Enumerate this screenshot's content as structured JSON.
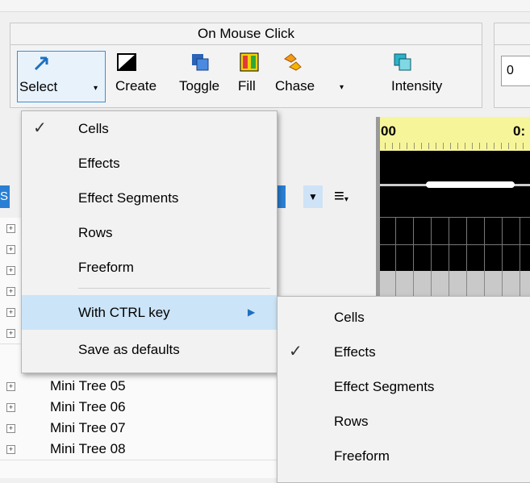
{
  "ribbon": {
    "group_title": "On Mouse Click",
    "buttons": [
      {
        "label": "Select"
      },
      {
        "label": "Create"
      },
      {
        "label": "Toggle"
      },
      {
        "label": "Fill"
      },
      {
        "label": "Chase"
      },
      {
        "label": "Intensity"
      }
    ],
    "value_field": "0"
  },
  "timeline": {
    "ruler_left": "00",
    "ruler_right": "0:"
  },
  "select_menu": {
    "items": [
      {
        "label": "Cells",
        "checked": true
      },
      {
        "label": "Effects",
        "checked": false
      },
      {
        "label": "Effect Segments",
        "checked": false
      },
      {
        "label": "Rows",
        "checked": false
      },
      {
        "label": "Freeform",
        "checked": false
      }
    ],
    "submenu_label": "With CTRL key",
    "save_defaults": "Save as defaults"
  },
  "ctrl_submenu": {
    "items": [
      {
        "label": "Cells",
        "checked": false
      },
      {
        "label": "Effects",
        "checked": true
      },
      {
        "label": "Effect Segments",
        "checked": false
      },
      {
        "label": "Rows",
        "checked": false
      },
      {
        "label": "Freeform",
        "checked": false
      }
    ]
  },
  "rows": [
    {
      "label": "Mini Tree 05"
    },
    {
      "label": "Mini Tree 06"
    },
    {
      "label": "Mini Tree 07"
    },
    {
      "label": "Mini Tree 08"
    }
  ],
  "colors": {
    "highlight": "#cce4f7",
    "ruler": "#f7f59a",
    "accent": "#3a8fd6"
  }
}
